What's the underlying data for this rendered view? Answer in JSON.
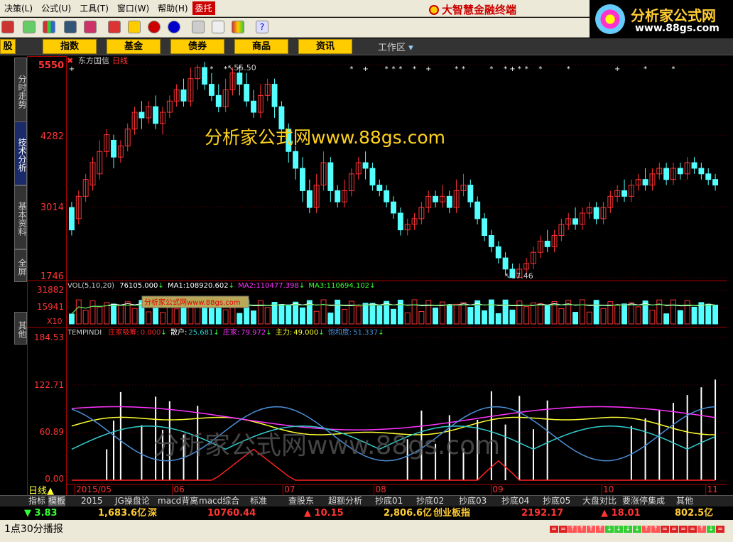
{
  "menu": [
    "决策(L)",
    "公式(U)",
    "工具(T)",
    "窗口(W)",
    "帮助(H)",
    "委托"
  ],
  "brand": "大智慧金融终端",
  "logo": {
    "line1": "分析家公式网",
    "line2": "www.88gs.com"
  },
  "categories": [
    "股",
    "指数",
    "基金",
    "债券",
    "商品",
    "资讯"
  ],
  "workarea": "工作区",
  "left_tabs": [
    "分时走势",
    "技术分析",
    "基本资料",
    "全屏",
    "其他"
  ],
  "stock": {
    "name": "东方国信",
    "period": "日线"
  },
  "watermark": "分析家公式网www.88gs.com",
  "watermark_big": "分析家公式网www.88gs.com",
  "watermark_small": "分析家公式网www.88gs.com",
  "price_axis": [
    "5550",
    "4282",
    "3014",
    "1746"
  ],
  "price_high": "55.50",
  "price_low": "17.46",
  "vol_axis": [
    "31882",
    "15941"
  ],
  "vol_mult": "X10",
  "vol_header": {
    "name": "VOL(5,10,20)",
    "v": "76105.000",
    "ma1l": "MA1:",
    "ma1": "108920.602",
    "ma2l": "MA2:",
    "ma2": "110477.398",
    "ma3l": "MA3:",
    "ma3": "110694.102"
  },
  "ind_axis": [
    "184.53",
    "122.71",
    "60.89",
    "0.00"
  ],
  "ind_header": {
    "name": "TEMPINDI",
    "a_l": "庄家吸筹:",
    "a": "0.000",
    "b_l": "散户:",
    "b": "25.681",
    "c_l": "庄家:",
    "c": "79.972",
    "d_l": "主力:",
    "d": "49.000",
    "e_l": "饱和度:",
    "e": "51.337"
  },
  "x_dates": [
    "2015/05",
    "06",
    "07",
    "08",
    "09",
    "10",
    "11"
  ],
  "period_label": "日线",
  "bottom_tabs": [
    "指标",
    "模板",
    "2015",
    "JG操盘论",
    "macd背离",
    "macd综合",
    "标准",
    "查股东",
    "超额分析",
    "抄底01",
    "抄底02",
    "抄底03",
    "抄底04",
    "抄底05",
    "大盘对比",
    "要涨停集成",
    "其他"
  ],
  "ticker": [
    {
      "t": "▼ 3.83",
      "c": "#3f3"
    },
    {
      "t": "1,683.6亿",
      "c": "#fc3"
    },
    {
      "t": "深",
      "c": "#fc3"
    },
    {
      "t": "10760.44",
      "c": "#f33"
    },
    {
      "t": "▲ 10.15",
      "c": "#f33"
    },
    {
      "t": "2,806.6亿",
      "c": "#fc3"
    },
    {
      "t": "创业板指",
      "c": "#fc3"
    },
    {
      "t": "2192.17",
      "c": "#f33"
    },
    {
      "t": "▲ 18.01",
      "c": "#f33"
    },
    {
      "t": "802.5亿",
      "c": "#fc3"
    }
  ],
  "status_text": "1点30分播报",
  "colors": {
    "up": "#ff3333",
    "down": "#54ffff",
    "vol_ma1": "#ffffff",
    "vol_ma2": "#ff33ff",
    "vol_ma3": "#33ff33",
    "line_yellow": "#ffff33",
    "line_magenta": "#ff33ff",
    "line_cyan": "#3cc",
    "line_blue": "#4a8fd8",
    "line_red": "#ff2222"
  },
  "chart_data": [
    {
      "type": "candlestick",
      "title": "东方国信 日线",
      "y_unit": "price ×100 on axis",
      "ylim": [
        1746,
        5550
      ],
      "candles": [
        [
          30,
          26,
          31,
          25
        ],
        [
          28,
          32,
          33,
          27
        ],
        [
          32,
          35,
          36,
          31
        ],
        [
          34,
          38,
          39,
          33
        ],
        [
          36,
          40,
          42,
          35
        ],
        [
          40,
          43,
          44,
          39
        ],
        [
          42,
          39,
          43,
          37
        ],
        [
          39,
          41,
          42,
          38
        ],
        [
          41,
          44,
          45,
          40
        ],
        [
          44,
          47,
          48,
          43
        ],
        [
          47,
          46,
          49,
          44
        ],
        [
          46,
          48,
          49,
          45
        ],
        [
          48,
          45,
          50,
          44
        ],
        [
          45,
          47,
          48,
          43
        ],
        [
          47,
          49,
          50,
          46
        ],
        [
          49,
          51,
          52,
          48
        ],
        [
          51,
          49,
          53,
          48
        ],
        [
          49,
          53,
          55,
          48
        ],
        [
          53,
          55,
          55.5,
          51
        ],
        [
          55,
          52,
          56,
          51
        ],
        [
          52,
          50,
          54,
          49
        ],
        [
          50,
          48,
          52,
          47
        ],
        [
          48,
          51,
          53,
          47
        ],
        [
          51,
          54,
          55,
          50
        ],
        [
          54,
          52,
          55.5,
          50
        ],
        [
          52,
          49,
          54,
          48
        ],
        [
          49,
          47,
          51,
          46
        ],
        [
          47,
          50,
          52,
          46
        ],
        [
          50,
          52,
          53,
          49
        ],
        [
          52,
          48,
          53,
          46
        ],
        [
          48,
          44,
          49,
          42
        ],
        [
          44,
          40,
          45,
          38
        ],
        [
          40,
          37,
          41,
          35
        ],
        [
          37,
          33,
          39,
          31
        ],
        [
          33,
          30,
          35,
          29
        ],
        [
          30,
          34,
          36,
          29
        ],
        [
          34,
          38,
          40,
          33
        ],
        [
          38,
          33,
          39,
          31
        ],
        [
          33,
          31,
          34,
          30
        ],
        [
          31,
          33,
          35,
          30
        ],
        [
          33,
          36,
          37,
          32
        ],
        [
          36,
          38,
          39,
          35
        ],
        [
          38,
          37,
          40,
          35
        ],
        [
          37,
          34,
          38,
          33
        ],
        [
          34,
          33,
          35,
          32
        ],
        [
          33,
          31,
          34,
          30
        ],
        [
          31,
          29,
          32,
          28
        ],
        [
          29,
          26,
          30,
          25
        ],
        [
          26,
          27,
          28,
          25
        ],
        [
          27,
          28,
          29,
          26
        ],
        [
          28,
          30,
          31,
          27
        ],
        [
          30,
          32,
          33,
          29
        ],
        [
          32,
          31,
          33,
          30
        ],
        [
          31,
          32,
          34,
          30
        ],
        [
          32,
          30,
          33,
          29
        ],
        [
          30,
          33,
          35,
          29
        ],
        [
          33,
          34,
          36,
          32
        ],
        [
          34,
          31,
          35,
          30
        ],
        [
          31,
          28,
          32,
          27
        ],
        [
          28,
          25,
          29,
          24
        ],
        [
          25,
          23,
          26,
          22
        ],
        [
          23,
          21,
          24,
          20
        ],
        [
          21,
          19,
          22,
          18
        ],
        [
          19,
          17.5,
          20,
          17.46
        ],
        [
          17.5,
          19,
          20,
          17.46
        ],
        [
          19,
          20,
          21,
          18
        ],
        [
          20,
          22,
          23,
          19
        ],
        [
          22,
          24,
          25,
          21
        ],
        [
          24,
          23,
          26,
          22
        ],
        [
          23,
          25,
          26,
          22
        ],
        [
          25,
          27,
          28,
          24
        ],
        [
          27,
          28,
          29,
          26
        ],
        [
          28,
          27,
          30,
          26
        ],
        [
          27,
          29,
          30,
          26
        ],
        [
          29,
          30,
          31,
          28
        ],
        [
          30,
          28,
          31,
          27
        ],
        [
          28,
          30,
          31,
          27
        ],
        [
          30,
          32,
          33,
          29
        ],
        [
          32,
          33,
          34,
          31
        ],
        [
          33,
          32,
          35,
          31
        ],
        [
          32,
          34,
          35,
          31
        ],
        [
          34,
          35,
          36,
          33
        ],
        [
          35,
          34,
          37,
          33
        ],
        [
          34,
          36,
          37,
          33
        ],
        [
          36,
          37,
          38,
          35
        ],
        [
          37,
          35,
          38,
          34
        ],
        [
          35,
          37,
          38,
          34
        ],
        [
          37,
          36,
          38,
          35
        ],
        [
          36,
          38,
          39,
          35
        ],
        [
          38,
          37,
          39,
          36
        ],
        [
          37,
          36,
          38,
          35
        ],
        [
          36,
          35,
          37,
          34
        ],
        [
          35,
          34,
          36,
          33
        ]
      ]
    },
    {
      "type": "bar",
      "title": "VOL(5,10,20)",
      "ylim": [
        0,
        31882
      ],
      "series": [
        {
          "name": "MA1",
          "values": [
            108920.602
          ]
        },
        {
          "name": "MA2",
          "values": [
            110477.398
          ]
        },
        {
          "name": "MA3",
          "values": [
            110694.102
          ]
        }
      ]
    },
    {
      "type": "line",
      "title": "TEMPINDI",
      "ylim": [
        0,
        184.53
      ],
      "series": [
        {
          "name": "庄家吸筹",
          "values": [
            0.0
          ]
        },
        {
          "name": "散户",
          "values": [
            25.681
          ]
        },
        {
          "name": "庄家",
          "values": [
            79.972
          ]
        },
        {
          "name": "主力",
          "values": [
            49.0
          ]
        },
        {
          "name": "饱和度",
          "values": [
            51.337
          ]
        }
      ]
    }
  ]
}
